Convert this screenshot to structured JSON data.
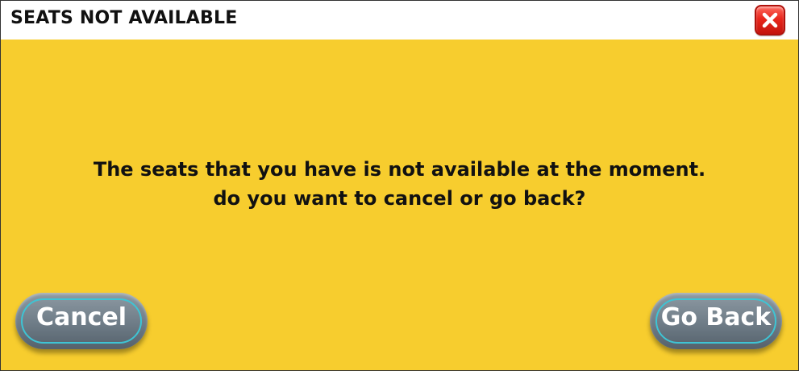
{
  "dialog": {
    "title": "SEATS NOT AVAILABLE",
    "close_icon": "close-x-icon",
    "message_line1": "The seats that you have is not available at the moment.",
    "message_line2": "do you want to cancel or go back?",
    "cancel_label": "Cancel",
    "go_back_label": "Go Back"
  },
  "colors": {
    "background": "#f7cd2e",
    "title_bar": "#ffffff",
    "close_button": "#e8261c",
    "button_fill": "#6e7c87",
    "button_ring": "#3ec4d4",
    "text": "#111111"
  }
}
